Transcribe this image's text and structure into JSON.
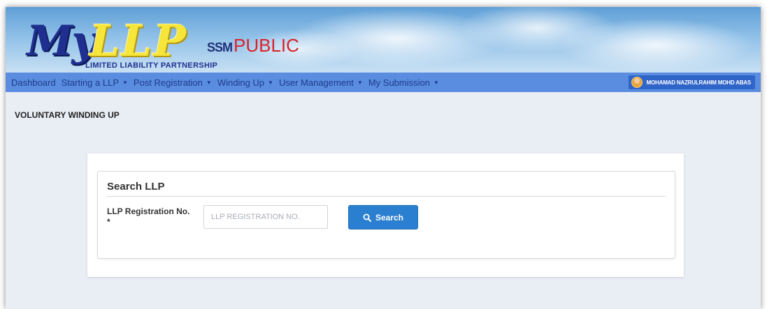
{
  "logo": {
    "my": "My",
    "llp": "LLP",
    "ssm": "SSM",
    "public": "PUBLIC",
    "subtitle": "LIMITED LIABILITY PARTNERSHIP"
  },
  "nav": {
    "items": [
      {
        "label": "Dashboard",
        "dropdown": false
      },
      {
        "label": "Starting a LLP",
        "dropdown": true
      },
      {
        "label": "Post Registration",
        "dropdown": true
      },
      {
        "label": "Winding Up",
        "dropdown": true
      },
      {
        "label": "User Management",
        "dropdown": true
      },
      {
        "label": "My Submission",
        "dropdown": true
      }
    ],
    "user_name": "MOHAMAD NAZRULRAHIM MOHD ABAS"
  },
  "page": {
    "title": "VOLUNTARY WINDING UP"
  },
  "search_panel": {
    "title": "Search LLP",
    "field_label": "LLP Registration No. *",
    "input_placeholder": "LLP REGISTRATION NO.",
    "input_value": "",
    "button_label": "Search"
  },
  "colors": {
    "navbar": "#5a8de0",
    "nav_text": "#1e3a8a",
    "button": "#2a7fd0",
    "public_text": "#d9232a",
    "background": "#e9edf4"
  }
}
